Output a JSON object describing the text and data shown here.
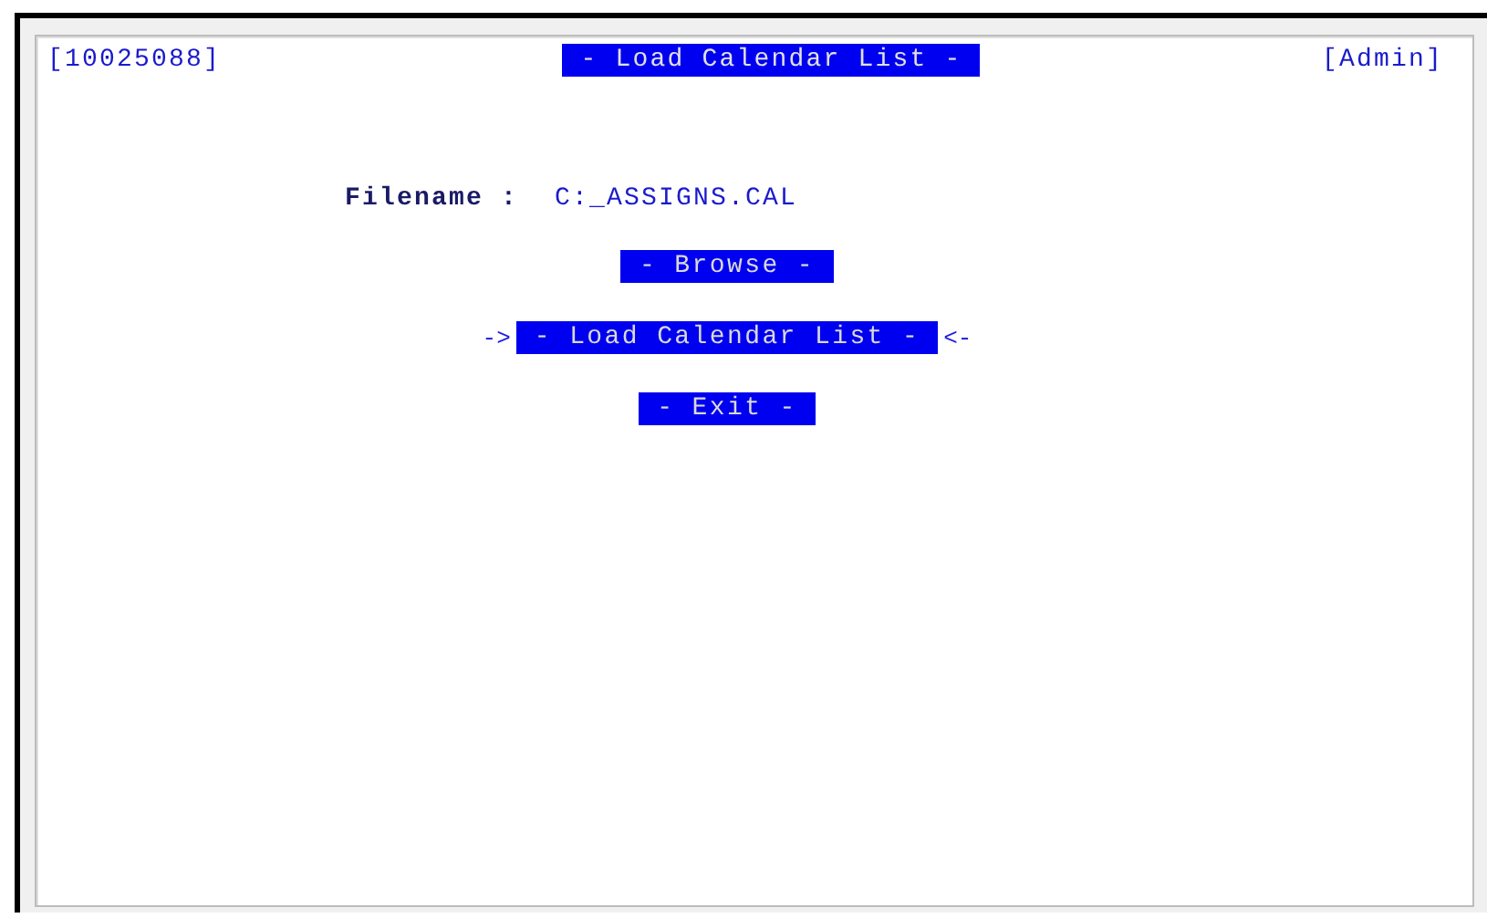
{
  "header": {
    "record_id": "[10025088]",
    "title": "- Load Calendar List -",
    "user": "[Admin]"
  },
  "filename": {
    "label": "Filename :",
    "value": "C:_ASSIGNS.CAL"
  },
  "focus_markers": {
    "left": "->",
    "right": "<-"
  },
  "buttons": [
    {
      "label": "- Browse -",
      "selected": false
    },
    {
      "label": "- Load Calendar List -",
      "selected": true
    },
    {
      "label": "- Exit -",
      "selected": false
    }
  ]
}
